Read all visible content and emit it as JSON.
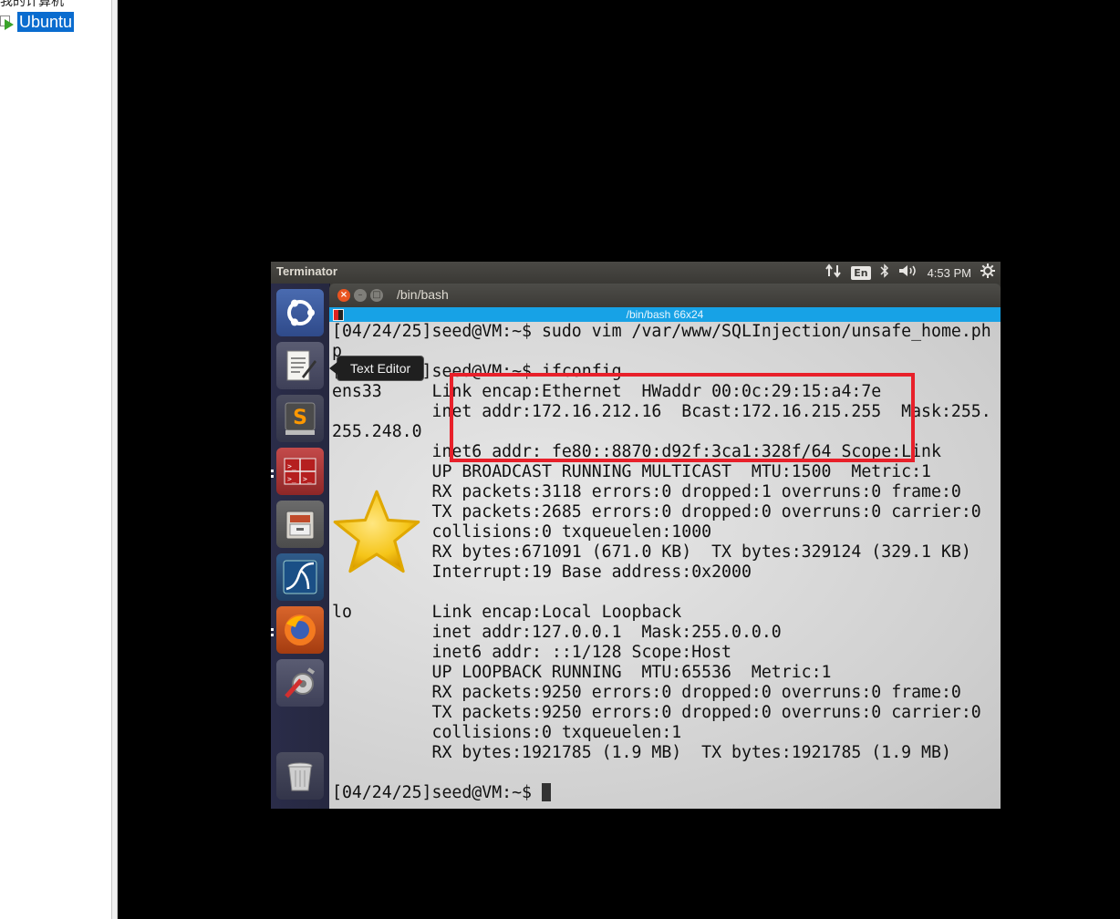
{
  "host": {
    "tree_top_label": "我的计算机",
    "selected_vm": "Ubuntu"
  },
  "top_panel": {
    "app_title": "Terminator",
    "language": "En",
    "clock": "4:53 PM"
  },
  "launcher": {
    "tooltip": "Text Editor",
    "items": [
      {
        "name": "ubuntu-dash"
      },
      {
        "name": "text-editor"
      },
      {
        "name": "sublime-text"
      },
      {
        "name": "terminator"
      },
      {
        "name": "files"
      },
      {
        "name": "wireshark"
      },
      {
        "name": "firefox"
      },
      {
        "name": "system-settings"
      },
      {
        "name": "trash"
      }
    ]
  },
  "window": {
    "title": "/bin/bash",
    "header": "/bin/bash 66x24"
  },
  "terminal": {
    "lines": [
      "[04/24/25]seed@VM:~$ sudo vim /var/www/SQLInjection/unsafe_home.ph",
      "p",
      "[04/24/25]seed@VM:~$ ifconfig",
      "ens33     Link encap:Ethernet  HWaddr 00:0c:29:15:a4:7e",
      "          inet addr:172.16.212.16  Bcast:172.16.215.255  Mask:255.",
      "255.248.0",
      "          inet6 addr: fe80::8870:d92f:3ca1:328f/64 Scope:Link",
      "          UP BROADCAST RUNNING MULTICAST  MTU:1500  Metric:1",
      "          RX packets:3118 errors:0 dropped:1 overruns:0 frame:0",
      "          TX packets:2685 errors:0 dropped:0 overruns:0 carrier:0",
      "          collisions:0 txqueuelen:1000",
      "          RX bytes:671091 (671.0 KB)  TX bytes:329124 (329.1 KB)",
      "          Interrupt:19 Base address:0x2000",
      "",
      "lo        Link encap:Local Loopback",
      "          inet addr:127.0.0.1  Mask:255.0.0.0",
      "          inet6 addr: ::1/128 Scope:Host",
      "          UP LOOPBACK RUNNING  MTU:65536  Metric:1",
      "          RX packets:9250 errors:0 dropped:0 overruns:0 frame:0",
      "          TX packets:9250 errors:0 dropped:0 overruns:0 carrier:0",
      "          collisions:0 txqueuelen:1",
      "          RX bytes:1921785 (1.9 MB)  TX bytes:1921785 (1.9 MB)",
      ""
    ],
    "prompt": "[04/24/25]seed@VM:~$ "
  },
  "colors": {
    "launcher_bg": "#2a2c49",
    "panel_bg": "#3c3b37",
    "term_header": "#17a2e6",
    "highlight": "#e8202a",
    "host_selection": "#0a6ccf"
  }
}
